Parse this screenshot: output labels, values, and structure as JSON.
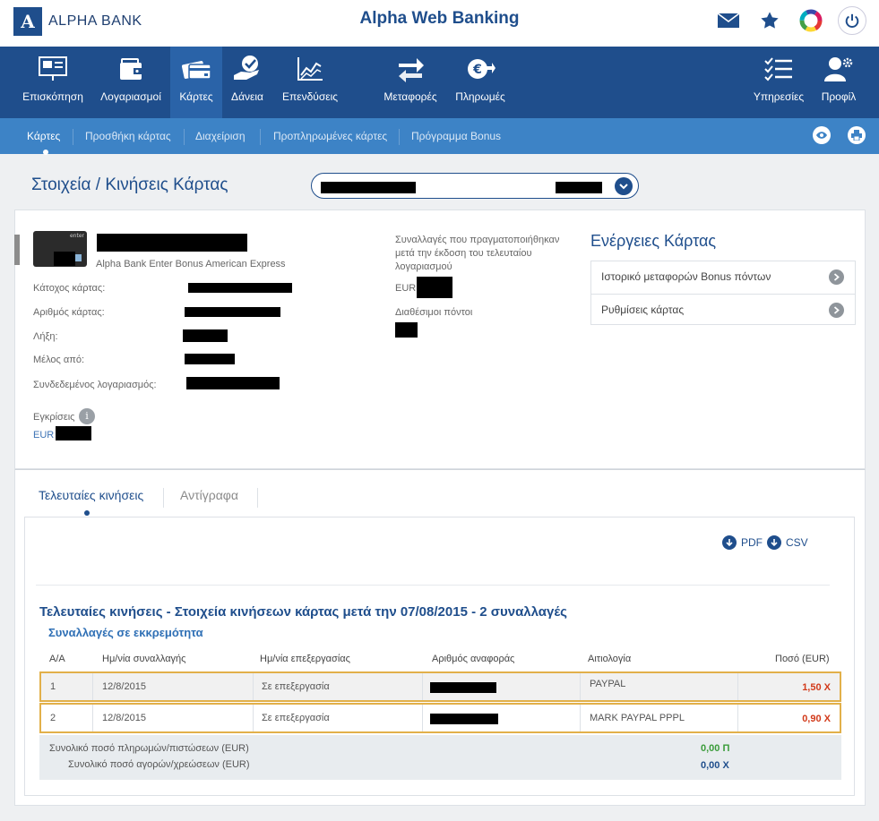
{
  "header": {
    "bank_name": "ALPHA BANK",
    "app_title": "Alpha Web Banking"
  },
  "main_nav": [
    {
      "label": "Επισκόπηση",
      "icon": "presentation-icon"
    },
    {
      "label": "Λογαριασμοί",
      "icon": "wallet-icon"
    },
    {
      "label": "Κάρτες",
      "icon": "cards-icon",
      "active": true
    },
    {
      "label": "Δάνεια",
      "icon": "hand-check-icon"
    },
    {
      "label": "Επενδύσεις",
      "icon": "chart-icon"
    },
    {
      "label": "Μεταφορές",
      "icon": "transfer-icon"
    },
    {
      "label": "Πληρωμές",
      "icon": "euro-payment-icon"
    },
    {
      "label": "Υπηρεσίες",
      "icon": "list-icon"
    },
    {
      "label": "Προφίλ",
      "icon": "user-gear-icon"
    }
  ],
  "sub_nav": [
    "Κάρτες",
    "Προσθήκη κάρτας",
    "Διαχείριση",
    "Προπληρωμένες κάρτες",
    "Πρόγραμμα Bonus"
  ],
  "page_title": "Στοιχεία / Κινήσεις Κάρτας",
  "card": {
    "card_image_label": "enter",
    "product_name": "Alpha Bank Enter Bonus American Express",
    "holder_label": "Κάτοχος κάρτας:",
    "number_label": "Αριθμός κάρτας:",
    "expiry_label": "Λήξη:",
    "member_since_label": "Μέλος από:",
    "linked_account_label": "Συνδεδεμένος λογαριασμός:",
    "approvals_label": "Εγκρίσεις",
    "approvals_currency": "EUR",
    "transactions_desc": "Συναλλαγές που πραγματοποιήθηκαν μετά την έκδοση του τελευταίου λογαριασμού",
    "transactions_currency": "EUR",
    "points_label": "Διαθέσιμοι πόντοι"
  },
  "card_actions": {
    "title": "Ενέργειες Κάρτας",
    "items": [
      "Ιστορικό μεταφορών Bonus πόντων",
      "Ρυθμίσεις κάρτας"
    ]
  },
  "tabs": [
    "Τελευταίες κινήσεις",
    "Αντίγραφα"
  ],
  "downloads": {
    "pdf": "PDF",
    "csv": "CSV"
  },
  "transactions": {
    "title": "Τελευταίες κινήσεις - Στοιχεία κινήσεων κάρτας μετά την 07/08/2015 - 2 συναλλαγές",
    "subtitle": "Συναλλαγές σε εκκρεμότητα",
    "columns": [
      "Α/Α",
      "Ημ/νία συναλλαγής",
      "Ημ/νία επεξεργασίας",
      "Αριθμός αναφοράς",
      "Αιτιολογία",
      "Ποσό (EUR)"
    ],
    "rows": [
      {
        "index": "1",
        "date": "12/8/2015",
        "processing": "Σε επεξεργασία",
        "reason": "PAYPAL",
        "amount": "1,50 Χ"
      },
      {
        "index": "2",
        "date": "12/8/2015",
        "processing": "Σε επεξεργασία",
        "reason": "MARK PAYPAL PPPL",
        "amount": "0,90 Χ"
      }
    ],
    "totals": {
      "credits_label": "Συνολικό ποσό πληρωμών/πιστώσεων (EUR)",
      "credits_value": "0,00 Π",
      "debits_label": "Συνολικό ποσό αγορών/χρεώσεων (EUR)",
      "debits_value": "0,00 Χ"
    }
  },
  "colors": {
    "brand": "#1f4e8c",
    "subnav": "#3d83c6",
    "credit": "#3a9c3a",
    "debit": "#d23a1a",
    "highlight": "#e2b04a"
  }
}
